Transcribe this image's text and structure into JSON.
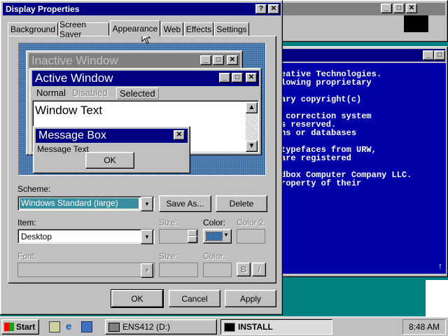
{
  "dialog": {
    "title": "Display Properties",
    "help_btn": "?",
    "close_btn": "✕",
    "tabs": [
      {
        "label": "Background"
      },
      {
        "label": "Screen Saver"
      },
      {
        "label": "Appearance"
      },
      {
        "label": "Web"
      },
      {
        "label": "Effects"
      },
      {
        "label": "Settings"
      }
    ],
    "preview": {
      "inactive_title": "Inactive Window",
      "active_title": "Active Window",
      "menu_normal": "Normal",
      "menu_disabled": "Disabled",
      "menu_selected": "Selected",
      "window_text": "Window Text",
      "msgbox_title": "Message Box",
      "msgbox_text": "Message Text",
      "msgbox_ok": "OK"
    },
    "scheme_label": "Scheme:",
    "scheme_value": "Windows Standard (large)",
    "save_as": "Save As...",
    "delete": "Delete",
    "item_label": "Item:",
    "item_value": "Desktop",
    "size_label": "Size:",
    "color_label": "Color:",
    "color2_label": "Color 2:",
    "font_label": "Font:",
    "size2_label": "Size:",
    "color3_label": "Color:",
    "bold_btn": "B",
    "italic_btn": "I",
    "ok": "OK",
    "cancel": "Cancel",
    "apply": "Apply",
    "desktop_color": "#3a6ea5"
  },
  "console": {
    "lines": [
      "eative Technologies.",
      "lowing proprietary",
      "",
      "ary copyright(c)",
      "",
      " correction system",
      "s reserved.",
      "ns or databases",
      "",
      "typefaces from URW,",
      "are registered",
      "",
      "dbox Computer Company LLC.",
      "roperty of their"
    ],
    "up_arrow": "↑"
  },
  "taskbar": {
    "start": "Start",
    "task1": "ENS412 (D:)",
    "task2": "INSTALL",
    "clock": "8:48 AM"
  }
}
